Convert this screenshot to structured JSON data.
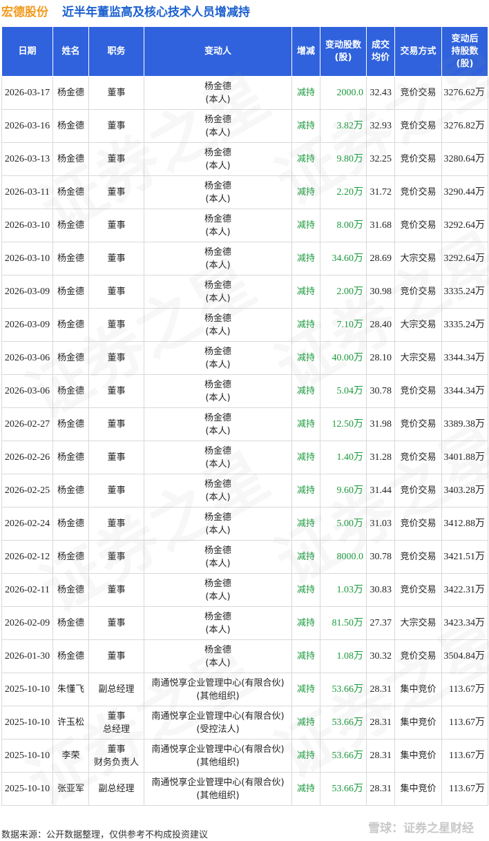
{
  "header": {
    "brand": "宏德股份",
    "title": "近半年董监高及核心技术人员增减持"
  },
  "table": {
    "columns": [
      "日期",
      "姓名",
      "职务",
      "变动人",
      "增减",
      "变动股数\n(股)",
      "成交\n均价",
      "交易方式",
      "变动后\n持股数\n(股)"
    ],
    "rows": [
      [
        "2026-03-17",
        "杨金德",
        "董事",
        "杨金德\n(本人)",
        "减持",
        "2000.0",
        "32.43",
        "竞价交易",
        "3276.62万"
      ],
      [
        "2026-03-16",
        "杨金德",
        "董事",
        "杨金德\n(本人)",
        "减持",
        "3.82万",
        "32.93",
        "竞价交易",
        "3276.82万"
      ],
      [
        "2026-03-13",
        "杨金德",
        "董事",
        "杨金德\n(本人)",
        "减持",
        "9.80万",
        "32.25",
        "竞价交易",
        "3280.64万"
      ],
      [
        "2026-03-11",
        "杨金德",
        "董事",
        "杨金德\n(本人)",
        "减持",
        "2.20万",
        "31.72",
        "竞价交易",
        "3290.44万"
      ],
      [
        "2026-03-10",
        "杨金德",
        "董事",
        "杨金德\n(本人)",
        "减持",
        "8.00万",
        "31.68",
        "竞价交易",
        "3292.64万"
      ],
      [
        "2026-03-10",
        "杨金德",
        "董事",
        "杨金德\n(本人)",
        "减持",
        "34.60万",
        "28.69",
        "大宗交易",
        "3292.64万"
      ],
      [
        "2026-03-09",
        "杨金德",
        "董事",
        "杨金德\n(本人)",
        "减持",
        "2.00万",
        "30.98",
        "竞价交易",
        "3335.24万"
      ],
      [
        "2026-03-09",
        "杨金德",
        "董事",
        "杨金德\n(本人)",
        "减持",
        "7.10万",
        "28.40",
        "大宗交易",
        "3335.24万"
      ],
      [
        "2026-03-06",
        "杨金德",
        "董事",
        "杨金德\n(本人)",
        "减持",
        "40.00万",
        "28.10",
        "大宗交易",
        "3344.34万"
      ],
      [
        "2026-03-06",
        "杨金德",
        "董事",
        "杨金德\n(本人)",
        "减持",
        "5.04万",
        "30.78",
        "竞价交易",
        "3344.34万"
      ],
      [
        "2026-02-27",
        "杨金德",
        "董事",
        "杨金德\n(本人)",
        "减持",
        "12.50万",
        "31.98",
        "竞价交易",
        "3389.38万"
      ],
      [
        "2026-02-26",
        "杨金德",
        "董事",
        "杨金德\n(本人)",
        "减持",
        "1.40万",
        "31.28",
        "竞价交易",
        "3401.88万"
      ],
      [
        "2026-02-25",
        "杨金德",
        "董事",
        "杨金德\n(本人)",
        "减持",
        "9.60万",
        "31.44",
        "竞价交易",
        "3403.28万"
      ],
      [
        "2026-02-24",
        "杨金德",
        "董事",
        "杨金德\n(本人)",
        "减持",
        "5.00万",
        "31.03",
        "竞价交易",
        "3412.88万"
      ],
      [
        "2026-02-12",
        "杨金德",
        "董事",
        "杨金德\n(本人)",
        "减持",
        "8000.0",
        "30.78",
        "竞价交易",
        "3421.51万"
      ],
      [
        "2026-02-11",
        "杨金德",
        "董事",
        "杨金德\n(本人)",
        "减持",
        "1.03万",
        "30.83",
        "竞价交易",
        "3422.31万"
      ],
      [
        "2026-02-09",
        "杨金德",
        "董事",
        "杨金德\n(本人)",
        "减持",
        "81.50万",
        "27.37",
        "大宗交易",
        "3423.34万"
      ],
      [
        "2026-01-30",
        "杨金德",
        "董事",
        "杨金德\n(本人)",
        "减持",
        "1.08万",
        "30.32",
        "竞价交易",
        "3504.84万"
      ],
      [
        "2025-10-10",
        "朱懂飞",
        "副总经理",
        "南通悦享企业管理中心(有限合伙)\n(其他组织)",
        "减持",
        "53.66万",
        "28.31",
        "集中竞价",
        "113.67万"
      ],
      [
        "2025-10-10",
        "许玉松",
        "董事\n总经理",
        "南通悦享企业管理中心(有限合伙)\n(受控法人)",
        "减持",
        "53.66万",
        "28.31",
        "集中竞价",
        "113.67万"
      ],
      [
        "2025-10-10",
        "李荣",
        "董事\n财务负责人",
        "南通悦享企业管理中心(有限合伙)\n(其他组织)",
        "减持",
        "53.66万",
        "28.31",
        "集中竞价",
        "113.67万"
      ],
      [
        "2025-10-10",
        "张亚军",
        "副总经理",
        "南通悦享企业管理中心(有限合伙)\n(其他组织)",
        "减持",
        "53.66万",
        "28.31",
        "集中竞价",
        "113.67万"
      ]
    ]
  },
  "footer": {
    "source": "数据来源：公开数据整理，仅供参考不构成投资建议",
    "logo": "雪球：证券之星财经"
  },
  "watermark": "证券之星",
  "colors": {
    "header_bg": "#2f62dc",
    "brand": "#f29a1e",
    "title": "#1b5fcf",
    "decrease": "#1a9a3c"
  }
}
